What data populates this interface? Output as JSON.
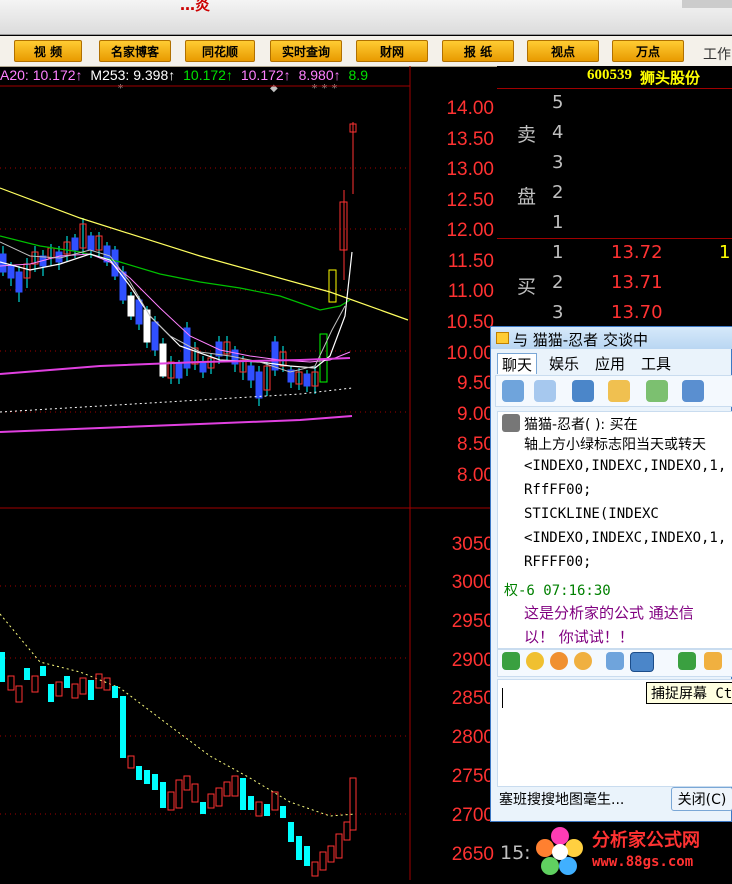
{
  "browser": {
    "title_fragment": "…炎",
    "brand_color": "#cc0000"
  },
  "toolbar": {
    "buttons": [
      "视 频",
      "名家博客",
      "同花顺",
      "实时查询",
      "财网",
      "报 纸",
      "视点",
      "万点"
    ],
    "extra": "工作"
  },
  "ma_legend": {
    "segments": [
      {
        "text": "A20: 10.172↑",
        "color": "#ff80ff"
      },
      {
        "text": "M253: 9.398↑",
        "color": "#ffffff"
      },
      {
        "text": "10.172↑",
        "color": "#00e000"
      },
      {
        "text": "10.172↑",
        "color": "#ff80ff"
      },
      {
        "text": "8.980↑",
        "color": "#ff80ff"
      },
      {
        "text": "8.9",
        "color": "#00e000"
      }
    ]
  },
  "price_axis": {
    "labels": [
      "14.00",
      "13.50",
      "13.00",
      "12.50",
      "12.00",
      "11.50",
      "11.00",
      "10.50",
      "10.00",
      "9.50",
      "9.00",
      "8.50",
      "8.00"
    ],
    "color": "#ff3232"
  },
  "index_axis": {
    "labels": [
      "3050",
      "3000",
      "2950",
      "2900",
      "2850",
      "2800",
      "2750",
      "2700",
      "2650"
    ],
    "color": "#ff3232"
  },
  "stock": {
    "code": "600539",
    "name": "狮头股份"
  },
  "order_book": {
    "sell_label_1": "卖",
    "sell_label_2": "盘",
    "sell_levels": [
      "5",
      "4",
      "3",
      "2",
      "1"
    ],
    "buy_label": "买",
    "buy_levels": [
      {
        "level": "1",
        "price": "13.72",
        "volume": "1"
      },
      {
        "level": "2",
        "price": "13.71",
        "volume": ""
      },
      {
        "level": "3",
        "price": "13.70",
        "volume": ""
      }
    ]
  },
  "chat": {
    "title": "与 猫猫-忍者 交谈中",
    "tabs": [
      "聊天",
      "娱乐",
      "应用",
      "工具"
    ],
    "sender": "猫猫-忍者(                ): 买在",
    "code_lines": [
      "轴上方小绿标志阳当天或转天",
      "<INDEXO,INDEXC,INDEXO,1,",
      "RffFF00;",
      "STICKLINE(INDEXC",
      "<INDEXO,INDEXC,INDEXO,1,",
      "RFFFF00;"
    ],
    "timestamp": "权-6 07:16:30",
    "reply_lines": [
      "这是分析家的公式 通达信",
      "以！ 你试试！！"
    ],
    "tooltip": "捕捉屏幕 Ct",
    "status": "塞班搜搜地图毫生...",
    "close_label": "关闭(C)"
  },
  "watermark": {
    "title": "分析家公式网",
    "url": "www.88gs.com"
  },
  "clock": "15:"
}
